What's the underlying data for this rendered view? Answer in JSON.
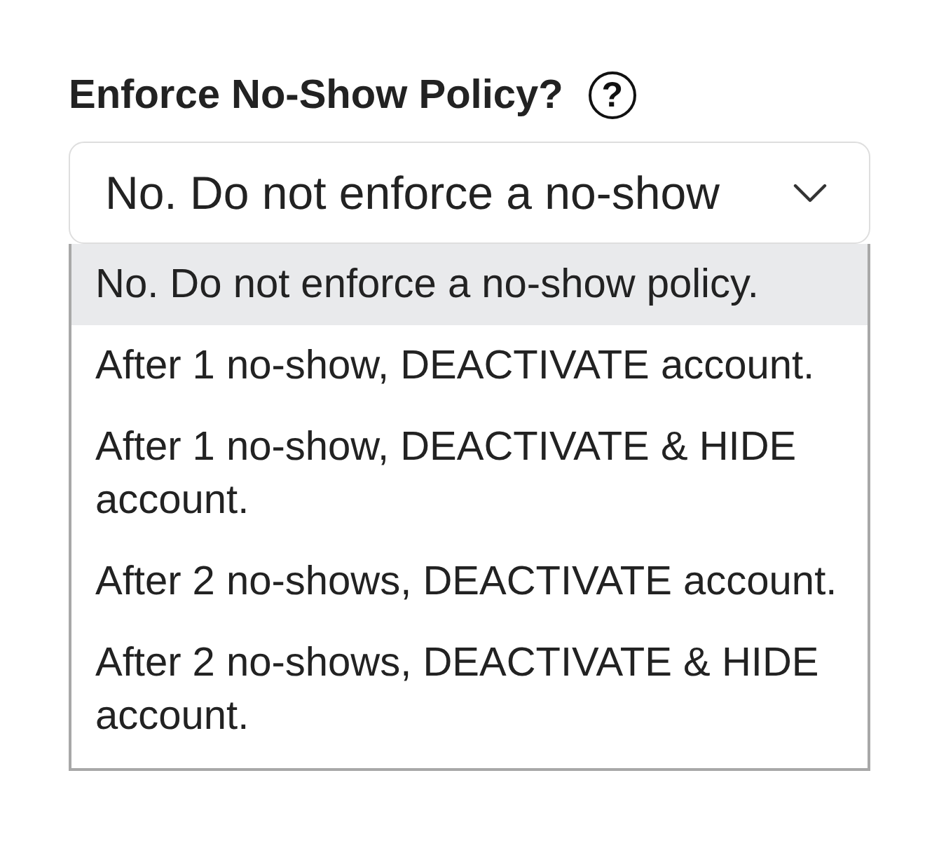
{
  "field": {
    "label": "Enforce No-Show Policy?",
    "help_icon": "?",
    "value": "No. Do not enforce a no-show",
    "expanded": true
  },
  "options": [
    {
      "label": "No. Do not enforce a no-show policy.",
      "selected": true
    },
    {
      "label": "After 1 no-show, DEACTIVATE account.",
      "selected": false
    },
    {
      "label": "After 1 no-show, DEACTIVATE & HIDE account.",
      "selected": false
    },
    {
      "label": "After 2 no-shows, DEACTIVATE account.",
      "selected": false
    },
    {
      "label": "After 2 no-shows, DEACTIVATE & HIDE account.",
      "selected": false
    }
  ]
}
